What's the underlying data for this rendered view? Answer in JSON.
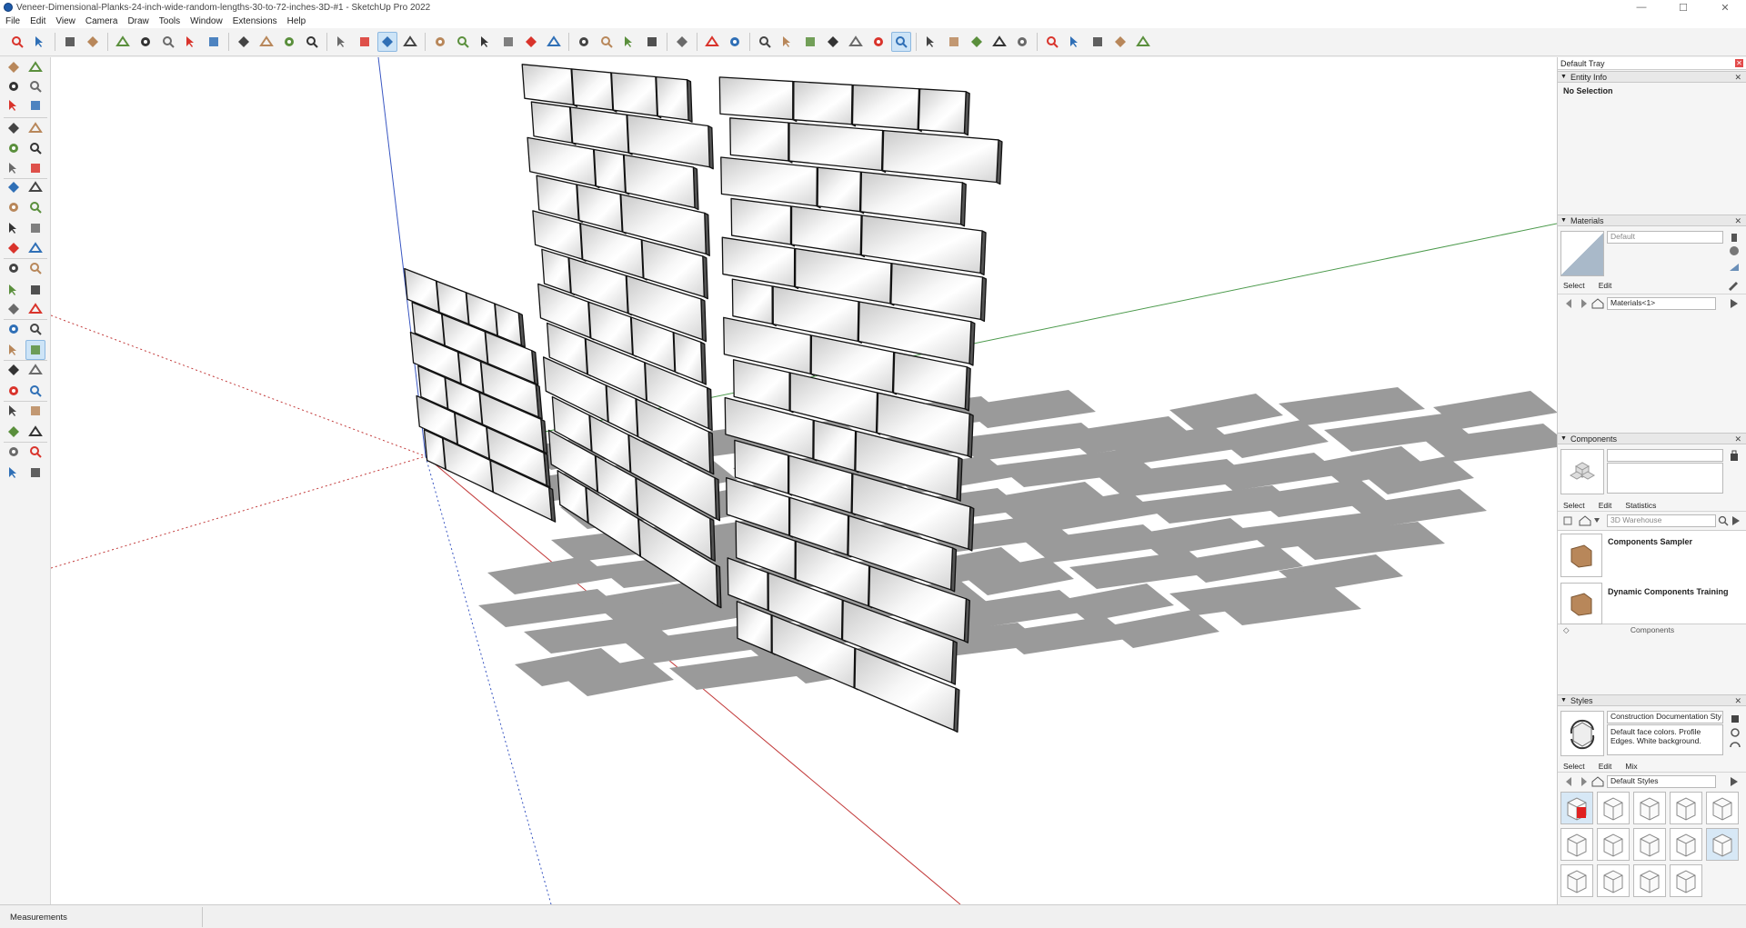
{
  "window": {
    "title": "Veneer-Dimensional-Planks-24-inch-wide-random-lengths-30-to-72-inches-3D-#1 - SketchUp Pro 2022",
    "controls": {
      "minimize": "—",
      "maximize": "☐",
      "close": "✕"
    }
  },
  "menu": [
    "File",
    "Edit",
    "View",
    "Camera",
    "Draw",
    "Tools",
    "Window",
    "Extensions",
    "Help"
  ],
  "toolbar": {
    "icons": [
      "search-icon",
      "select-arrow-icon",
      "eraser-icon",
      "pencil-line-icon",
      "arc-icon",
      "rectangle-icon",
      "push-pull-icon",
      "follow-me-icon",
      "move-icon",
      "rotate-icon",
      "scale-icon",
      "tape-measure-icon",
      "text-icon",
      "paint-bucket-icon",
      "orbit-icon",
      "pan-icon",
      "zoom-icon",
      "zoom-extents-icon",
      "sandbox-icon",
      "layers-icon",
      "components-icon",
      "section-icon",
      "warehouse-icon",
      "iso-view-icon",
      "top-view-icon",
      "front-view-icon",
      "right-view-icon",
      "back-view-icon",
      "left-view-icon",
      "xray-icon",
      "wireframe-icon",
      "hidden-line-icon",
      "shaded-icon",
      "textured-icon",
      "monochrome-icon",
      "orbit-icon-2",
      "pan-icon-2",
      "zoom-icon-2",
      "zoom-window-icon",
      "zoom-extents-icon-2",
      "previous-view-icon",
      "look-around-icon",
      "walk-icon",
      "position-camera-icon",
      "section-plane-icon",
      "section-fill-icon",
      "section-cut-icon"
    ]
  },
  "colors": {
    "axis_red": "#c23a3a",
    "axis_green": "#4c9a4c",
    "axis_blue": "#3a57c2",
    "shadow": "#999999",
    "edge": "#111111",
    "accent_icon_red": "#d9332b",
    "accent_icon_blue": "#2f6fb6"
  },
  "tray": {
    "title": "Default Tray",
    "entity_info": {
      "header": "Entity Info",
      "value": "No Selection"
    },
    "materials": {
      "header": "Materials",
      "name": "Default",
      "tabs": [
        "Select",
        "Edit"
      ],
      "library": "Materials<1>"
    },
    "components": {
      "header": "Components",
      "tabs": [
        "Select",
        "Edit",
        "Statistics"
      ],
      "search_placeholder": "3D Warehouse",
      "items": [
        "Components Sampler",
        "Dynamic Components Training"
      ],
      "footer": "Components"
    },
    "styles": {
      "header": "Styles",
      "name": "Construction Documentation Sty",
      "description": "Default face colors. Profile Edges. White background.",
      "tabs": [
        "Select",
        "Edit",
        "Mix"
      ],
      "library": "Default Styles"
    }
  },
  "status": {
    "measurements_label": "Measurements"
  }
}
